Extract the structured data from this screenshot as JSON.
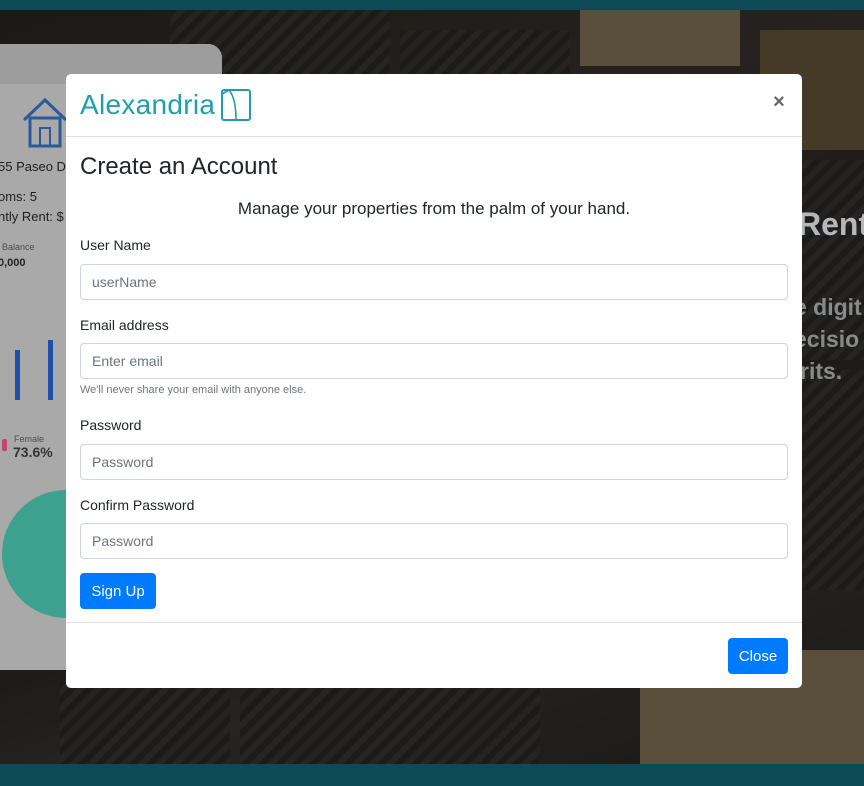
{
  "background": {
    "card": {
      "address": "55 Paseo Dr",
      "rooms": "oms: 5",
      "rent": "ntly Rent: $",
      "balance_label": "Balance",
      "balance_value": "0,000",
      "female_label": "Female",
      "female_pct": "73.6%"
    },
    "hero": {
      "title": "Rent",
      "line1": "e digit",
      "line2": "ecisio",
      "line3": "rits."
    }
  },
  "modal": {
    "brand": "Alexandria",
    "close_symbol": "×",
    "title": "Create an Account",
    "tagline": "Manage your properties from the palm of your hand.",
    "fields": {
      "username": {
        "label": "User Name",
        "placeholder": "userName"
      },
      "email": {
        "label": "Email address",
        "placeholder": "Enter email",
        "help": "We'll never share your email with anyone else."
      },
      "password": {
        "label": "Password",
        "placeholder": "Password"
      },
      "confirm": {
        "label": "Confirm Password",
        "placeholder": "Password"
      }
    },
    "signup_label": "Sign Up",
    "close_label": "Close"
  },
  "colors": {
    "brand": "#1f9fad",
    "primary": "#007bff",
    "band": "#0c4a56"
  }
}
